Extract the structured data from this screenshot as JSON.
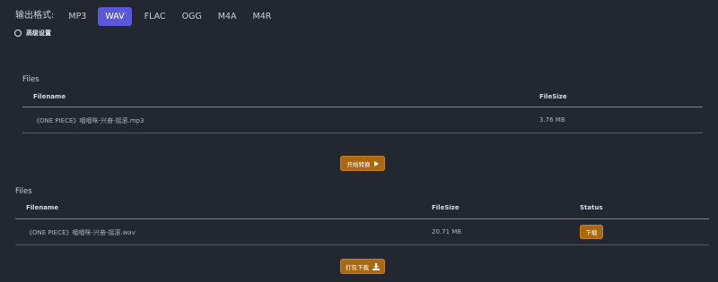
{
  "format": {
    "label": "输出格式:",
    "options": [
      "MP3",
      "WAV",
      "FLAC",
      "OGG",
      "M4A",
      "M4R"
    ],
    "selected": "WAV"
  },
  "advanced": {
    "label": "高级设置"
  },
  "input_table": {
    "title": "Files",
    "headers": {
      "filename": "Filename",
      "filesize": "FileSize"
    },
    "rows": [
      {
        "filename": "《ONE PIECE》咽咽咪-兴奋-摇滚.mp3",
        "filesize": "3.76 MB"
      }
    ]
  },
  "convert_button": {
    "label": "开始转换",
    "icon": "play-icon"
  },
  "output_table": {
    "title": "Files",
    "headers": {
      "filename": "Filename",
      "filesize": "FileSize",
      "status": "Status"
    },
    "rows": [
      {
        "filename": "《ONE PIECE》咽咽咪-兴奋-摇滚.wav",
        "filesize": "20.71 MB",
        "status_button": "下载"
      }
    ]
  },
  "pack_button": {
    "label": "打包下载",
    "icon": "download-icon"
  },
  "colors": {
    "background": "#232730",
    "accent": "#5a57d9",
    "action": "#a96811"
  }
}
